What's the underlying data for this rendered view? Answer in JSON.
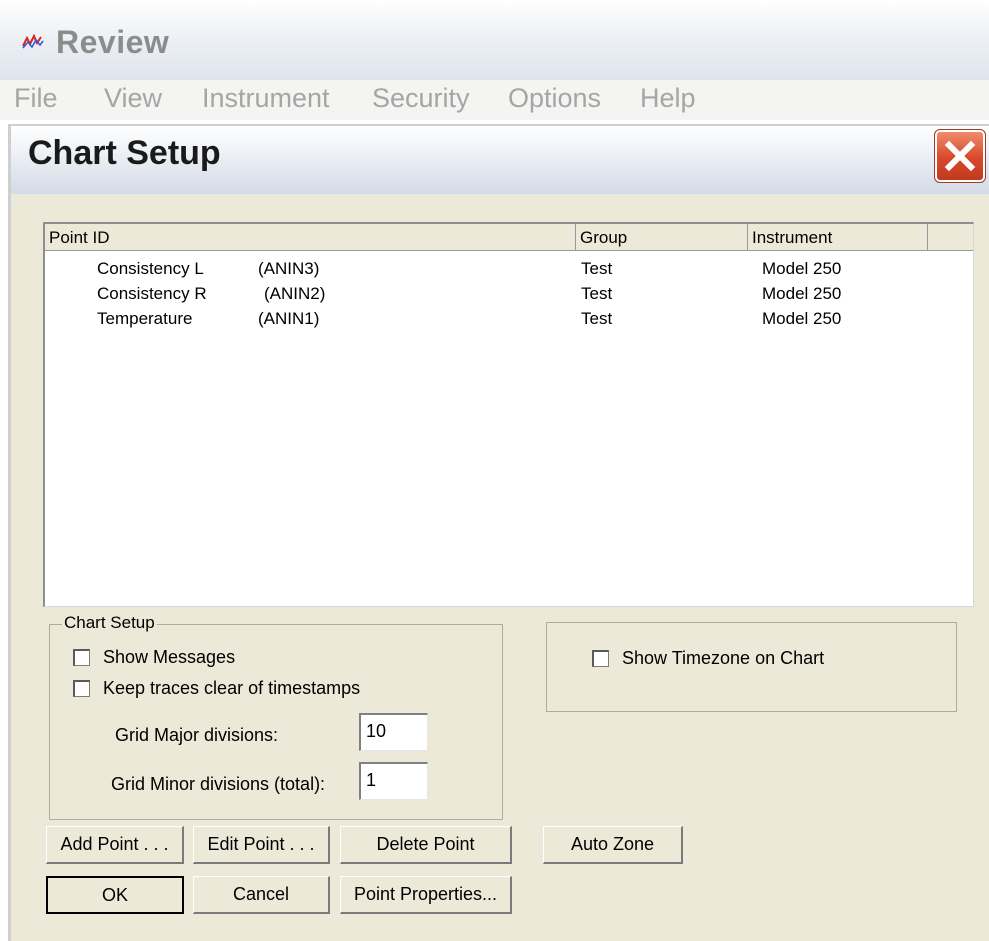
{
  "app": {
    "title": "Review",
    "menu": [
      "File",
      "View",
      "Instrument",
      "Security",
      "Options",
      "Help"
    ]
  },
  "dialog": {
    "title": "Chart Setup",
    "list": {
      "columns": [
        "Point ID",
        "Group",
        "Instrument"
      ],
      "rows": [
        {
          "name": "Consistency L",
          "channel": "(ANIN3)",
          "group": "Test",
          "instrument": "Model 250"
        },
        {
          "name": "Consistency R",
          "channel": "(ANIN2)",
          "group": "Test",
          "instrument": "Model 250"
        },
        {
          "name": "Temperature",
          "channel": "(ANIN1)",
          "group": "Test",
          "instrument": "Model 250"
        }
      ]
    },
    "chart_setup": {
      "legend": "Chart Setup",
      "show_messages": {
        "label": "Show Messages",
        "checked": false
      },
      "keep_traces": {
        "label": "Keep traces clear of timestamps",
        "checked": false
      },
      "grid_major_label": "Grid Major divisions:",
      "grid_major_value": "10",
      "grid_minor_label": "Grid Minor divisions (total):",
      "grid_minor_value": "1"
    },
    "timezone": {
      "label": "Show Timezone on Chart",
      "checked": false
    },
    "buttons": {
      "add_point": "Add Point . . .",
      "edit_point": "Edit Point . . .",
      "delete_point": "Delete Point",
      "auto_zone": "Auto Zone",
      "ok": "OK",
      "cancel": "Cancel",
      "point_properties": "Point Properties..."
    }
  }
}
